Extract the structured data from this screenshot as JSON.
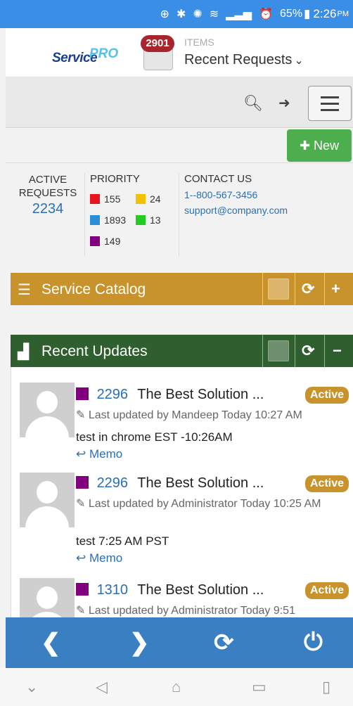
{
  "status_bar": {
    "battery": "65%",
    "time": "2:26",
    "ampm": "PM"
  },
  "header": {
    "logo_text": "ServicePRO",
    "logo_part1": "Service",
    "logo_part2": "PRO",
    "items_badge": "2901",
    "items_label": "ITEMS",
    "page_title": "Recent Requests",
    "dropdown_caret": "⌄"
  },
  "actions": {
    "new_label": "New"
  },
  "stats": {
    "active_label_1": "ACTIVE",
    "active_label_2": "REQUESTS",
    "active_count": "2234",
    "priority_label": "PRIORITY",
    "priorities": [
      {
        "color": "#e8141e",
        "count": "155"
      },
      {
        "color": "#f5c000",
        "count": "24"
      },
      {
        "color": "#2b8fd8",
        "count": "1893"
      },
      {
        "color": "#22cc22",
        "count": "13"
      },
      {
        "color": "#800080",
        "count": "149"
      }
    ],
    "contact_label": "CONTACT US",
    "phone": "1--800-567-3456",
    "email": "support@company.com"
  },
  "panels": {
    "service_catalog": {
      "title": "Service Catalog",
      "color": "#c8932c"
    },
    "recent_updates": {
      "title": "Recent Updates",
      "color": "#2f5f2f"
    }
  },
  "updates": [
    {
      "id": "2296",
      "title": "The Best Solution ...",
      "status": "Active",
      "meta": "Last updated by Mandeep Today 10:27 AM",
      "text": "test in chrome EST -10:26AM",
      "memo": "Memo"
    },
    {
      "id": "2296",
      "title": "The Best Solution ...",
      "status": "Active",
      "meta": "Last updated by Administrator Today 10:25 AM",
      "text": "test 7:25  AM PST",
      "memo": "Memo"
    },
    {
      "id": "1310",
      "title": "The Best Solution ...",
      "status": "Active",
      "meta": "Last updated by Administrator Today 9:51",
      "text": "",
      "memo": ""
    }
  ],
  "colors": {
    "accent_blue": "#3a7fc1",
    "green": "#4cae4c",
    "gold": "#c8932c",
    "dark_green": "#2f5f2f"
  }
}
